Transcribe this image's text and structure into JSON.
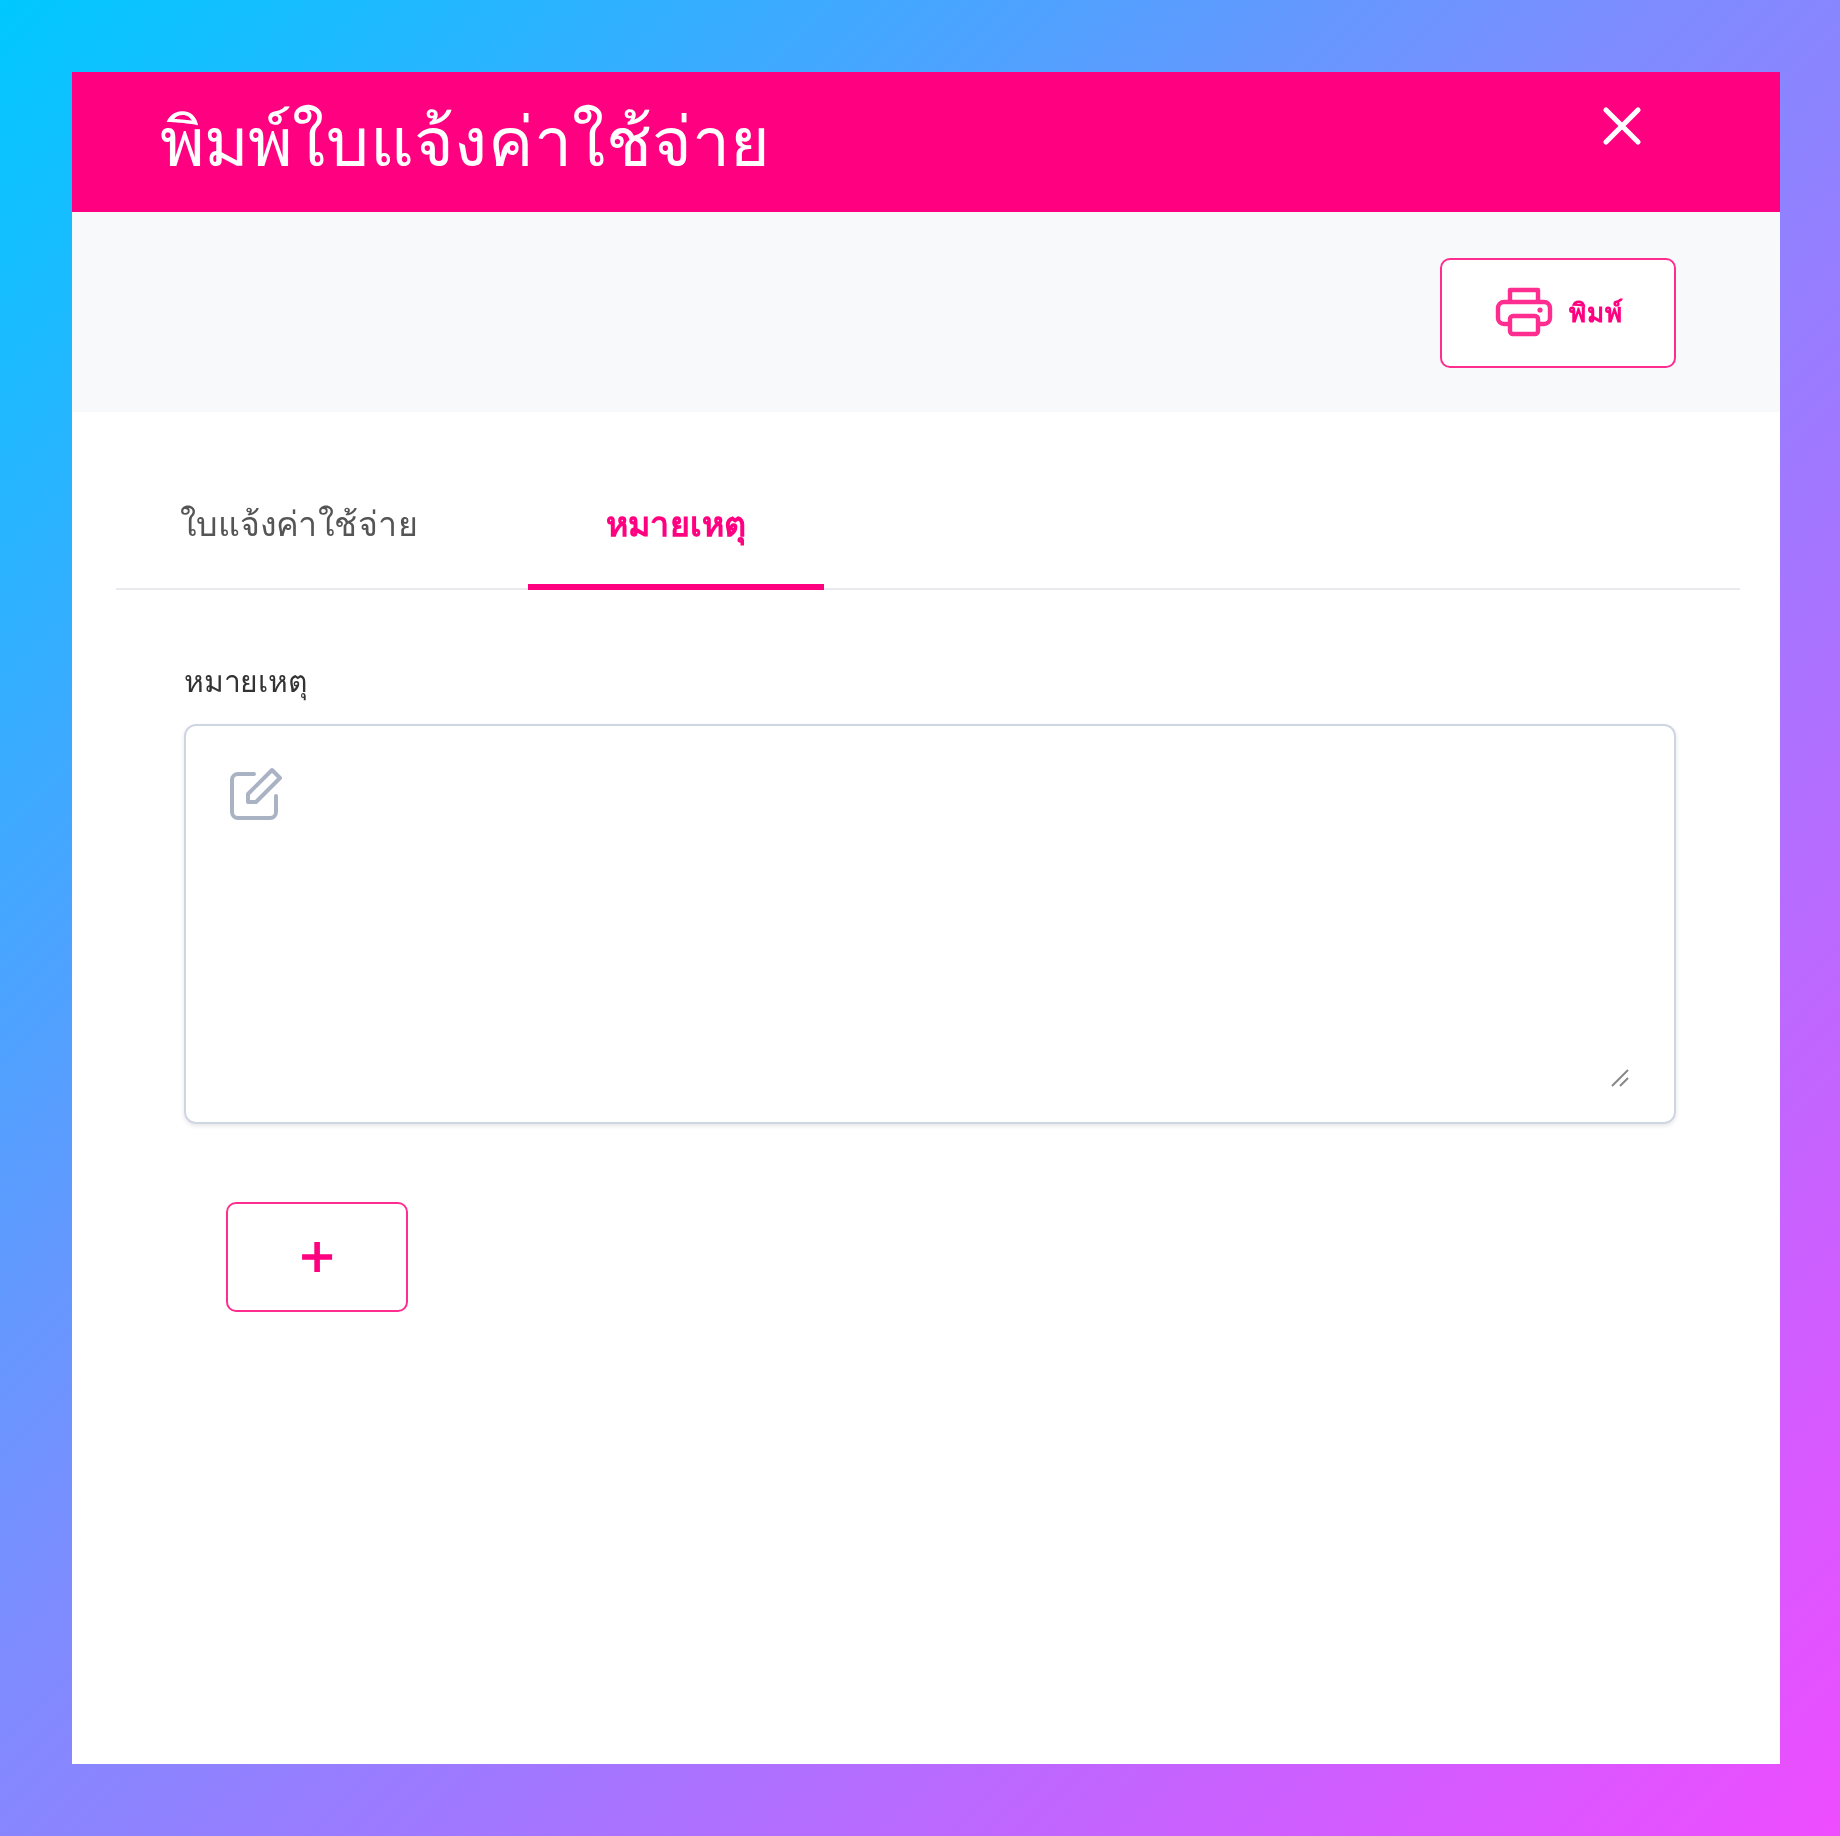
{
  "dialog": {
    "title": "พิมพ์ใบแจ้งค่าใช้จ่าย"
  },
  "toolbar": {
    "print_button": "พิมพ์"
  },
  "tabs": [
    {
      "label": "ใบแจ้งค่าใช้จ่าย",
      "selected": false
    },
    {
      "label": "หมายเหตุ",
      "selected": true
    }
  ],
  "note_field": {
    "label": "หมายเหตุ"
  },
  "add_button": "+"
}
